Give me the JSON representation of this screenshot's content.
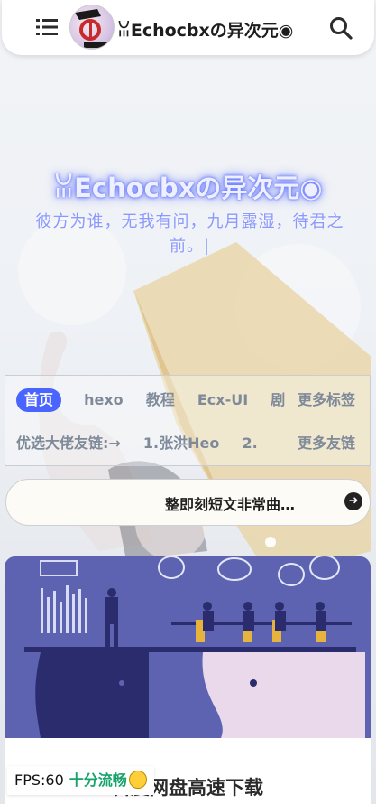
{
  "header": {
    "site_title": "ꈍEchocbxの异次元◉",
    "menu_icon": "list-icon",
    "search_icon": "search-icon",
    "avatar_alt": "Echo"
  },
  "hero": {
    "title": "ꈍEchocbxの异次元◉",
    "subtitle": "彼方为谁，无我有问，九月露湿，待君之前。|"
  },
  "categories": {
    "tags": [
      "首页",
      "hexo",
      "教程",
      "Ecx-UI",
      "剧"
    ],
    "more_tags": "更多标签",
    "friends_prefix": "优选大佬友链:→",
    "friends": [
      "1.张洪Heo",
      "2."
    ],
    "more_friends": "更多友链"
  },
  "notice": {
    "text": "整即刻短文非常曲…",
    "arrow_icon": "arrow-right-icon"
  },
  "post": {
    "title": "百度网盘高速下载"
  },
  "fps": {
    "label": "FPS:60",
    "status": "十分流畅",
    "emoji": "laughing-emoji-icon"
  },
  "colors": {
    "accent": "#4a64ff",
    "hero_glow": "#6c7dff",
    "cover_bg": "#5d63b0",
    "fps_good": "#18a36b"
  }
}
